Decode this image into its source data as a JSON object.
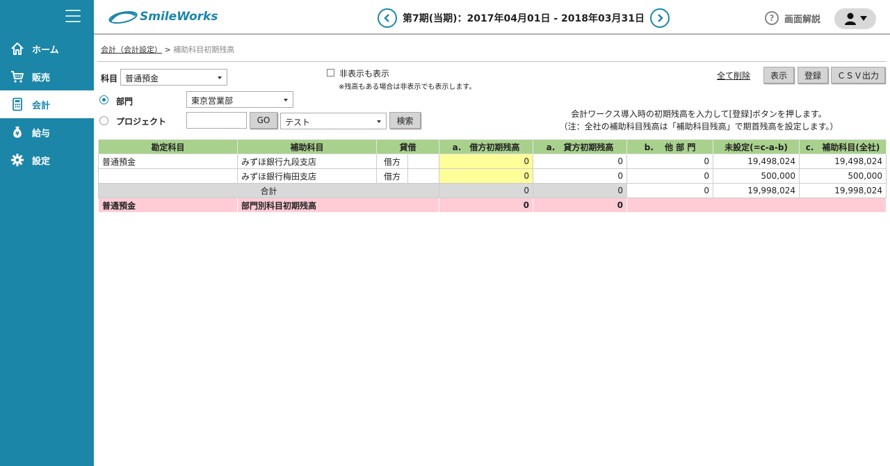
{
  "nav": {
    "items": [
      {
        "label": "ホーム",
        "icon": "home-icon"
      },
      {
        "label": "販売",
        "icon": "cart-icon"
      },
      {
        "label": "会計",
        "icon": "calculator-icon"
      },
      {
        "label": "給与",
        "icon": "money-bag-icon"
      },
      {
        "label": "設定",
        "icon": "gear-icon"
      }
    ],
    "active": "会計"
  },
  "header": {
    "logo": "SmileWorks",
    "period": "第7期(当期)：2017年04月01日 - 2018年03月31日",
    "help_label": "画面解説"
  },
  "breadcrumb": {
    "link": "会計（会計設定）",
    "separator": " > ",
    "current": "補助科目初期残高"
  },
  "form": {
    "account_label": "科目",
    "account_value": "普通預金",
    "show_hidden_label": "非表示も表示",
    "show_hidden_note": "※残高もある場合は非表示でも表示します。",
    "dept_label": "部門",
    "dept_value": "東京営業部",
    "project_label": "プロジェクト",
    "go_label": "GO",
    "project_value": "テスト",
    "search_label": "検索",
    "delete_all_label": "全て削除",
    "display_label": "表示",
    "register_label": "登録",
    "csv_label": "ＣＳＶ出力",
    "note_line1": "会計ワークス導入時の初期残高を入力して[登録]ボタンを押します。",
    "note_line2": "（注：全社の補助科目残高は「補助科目残高」で期首残高を設定します。）"
  },
  "table": {
    "headers": [
      "勘定科目",
      "補助科目",
      "貸借",
      "a.　借方初期残高",
      "a.　貸方初期残高",
      "b.　 他 部 門",
      "未設定(=c-a-b)",
      "c.　補助科目(全社)"
    ],
    "rows": [
      {
        "account": "普通預金",
        "sub": "みずほ銀行九段支店",
        "side": "借方",
        "debit": "0",
        "credit": "0",
        "other": "0",
        "unset": "19,498,024",
        "total": "19,498,024"
      },
      {
        "account": "",
        "sub": "みずほ銀行梅田支店",
        "side": "借方",
        "debit": "0",
        "credit": "0",
        "other": "0",
        "unset": "500,000",
        "total": "500,000"
      }
    ],
    "total_row": {
      "label": "合計",
      "debit": "0",
      "credit": "0",
      "other": "0",
      "unset": "19,998,024",
      "total": "19,998,024"
    },
    "pink_row": {
      "account": "普通預金",
      "label": "部門別科目初期残高",
      "debit": "0",
      "credit": "0"
    }
  }
}
